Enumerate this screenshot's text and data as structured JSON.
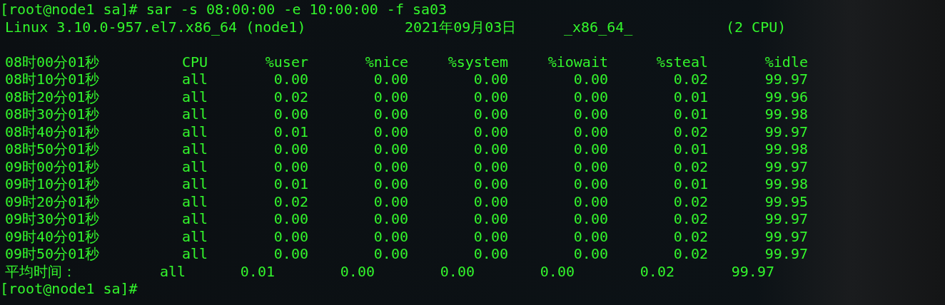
{
  "prompt_line": "[root@node1 sa]# sar -s 08:00:00 -e 10:00:00 -f sa03",
  "system_info": {
    "kernel": "Linux 3.10.0-957.el7.x86_64 (node1)",
    "date": "2021年09月03日",
    "arch": "_x86_64_",
    "cpus": "(2 CPU)"
  },
  "table": {
    "columns": [
      "08时00分01秒",
      "CPU",
      "%user",
      "%nice",
      "%system",
      "%iowait",
      "%steal",
      "%idle"
    ],
    "rows": [
      [
        "08时10分01秒",
        "all",
        "0.00",
        "0.00",
        "0.00",
        "0.00",
        "0.02",
        "99.97"
      ],
      [
        "08时20分01秒",
        "all",
        "0.02",
        "0.00",
        "0.00",
        "0.00",
        "0.01",
        "99.96"
      ],
      [
        "08时30分01秒",
        "all",
        "0.00",
        "0.00",
        "0.00",
        "0.00",
        "0.01",
        "99.98"
      ],
      [
        "08时40分01秒",
        "all",
        "0.01",
        "0.00",
        "0.00",
        "0.00",
        "0.02",
        "99.97"
      ],
      [
        "08时50分01秒",
        "all",
        "0.00",
        "0.00",
        "0.00",
        "0.00",
        "0.01",
        "99.98"
      ],
      [
        "09时00分01秒",
        "all",
        "0.00",
        "0.00",
        "0.00",
        "0.00",
        "0.02",
        "99.97"
      ],
      [
        "09时10分01秒",
        "all",
        "0.01",
        "0.00",
        "0.00",
        "0.00",
        "0.01",
        "99.98"
      ],
      [
        "09时20分01秒",
        "all",
        "0.02",
        "0.00",
        "0.00",
        "0.00",
        "0.02",
        "99.95"
      ],
      [
        "09时30分01秒",
        "all",
        "0.00",
        "0.00",
        "0.00",
        "0.00",
        "0.02",
        "99.97"
      ],
      [
        "09时40分01秒",
        "all",
        "0.00",
        "0.00",
        "0.00",
        "0.00",
        "0.02",
        "99.97"
      ],
      [
        "09时50分01秒",
        "all",
        "0.00",
        "0.00",
        "0.00",
        "0.00",
        "0.02",
        "99.97"
      ]
    ]
  },
  "average": {
    "label": "平均时间：",
    "cells": [
      "all",
      "0.01",
      "0.00",
      "0.00",
      "0.00",
      "0.02",
      "99.97"
    ]
  },
  "next_prompt": "[root@node1 sa]#"
}
